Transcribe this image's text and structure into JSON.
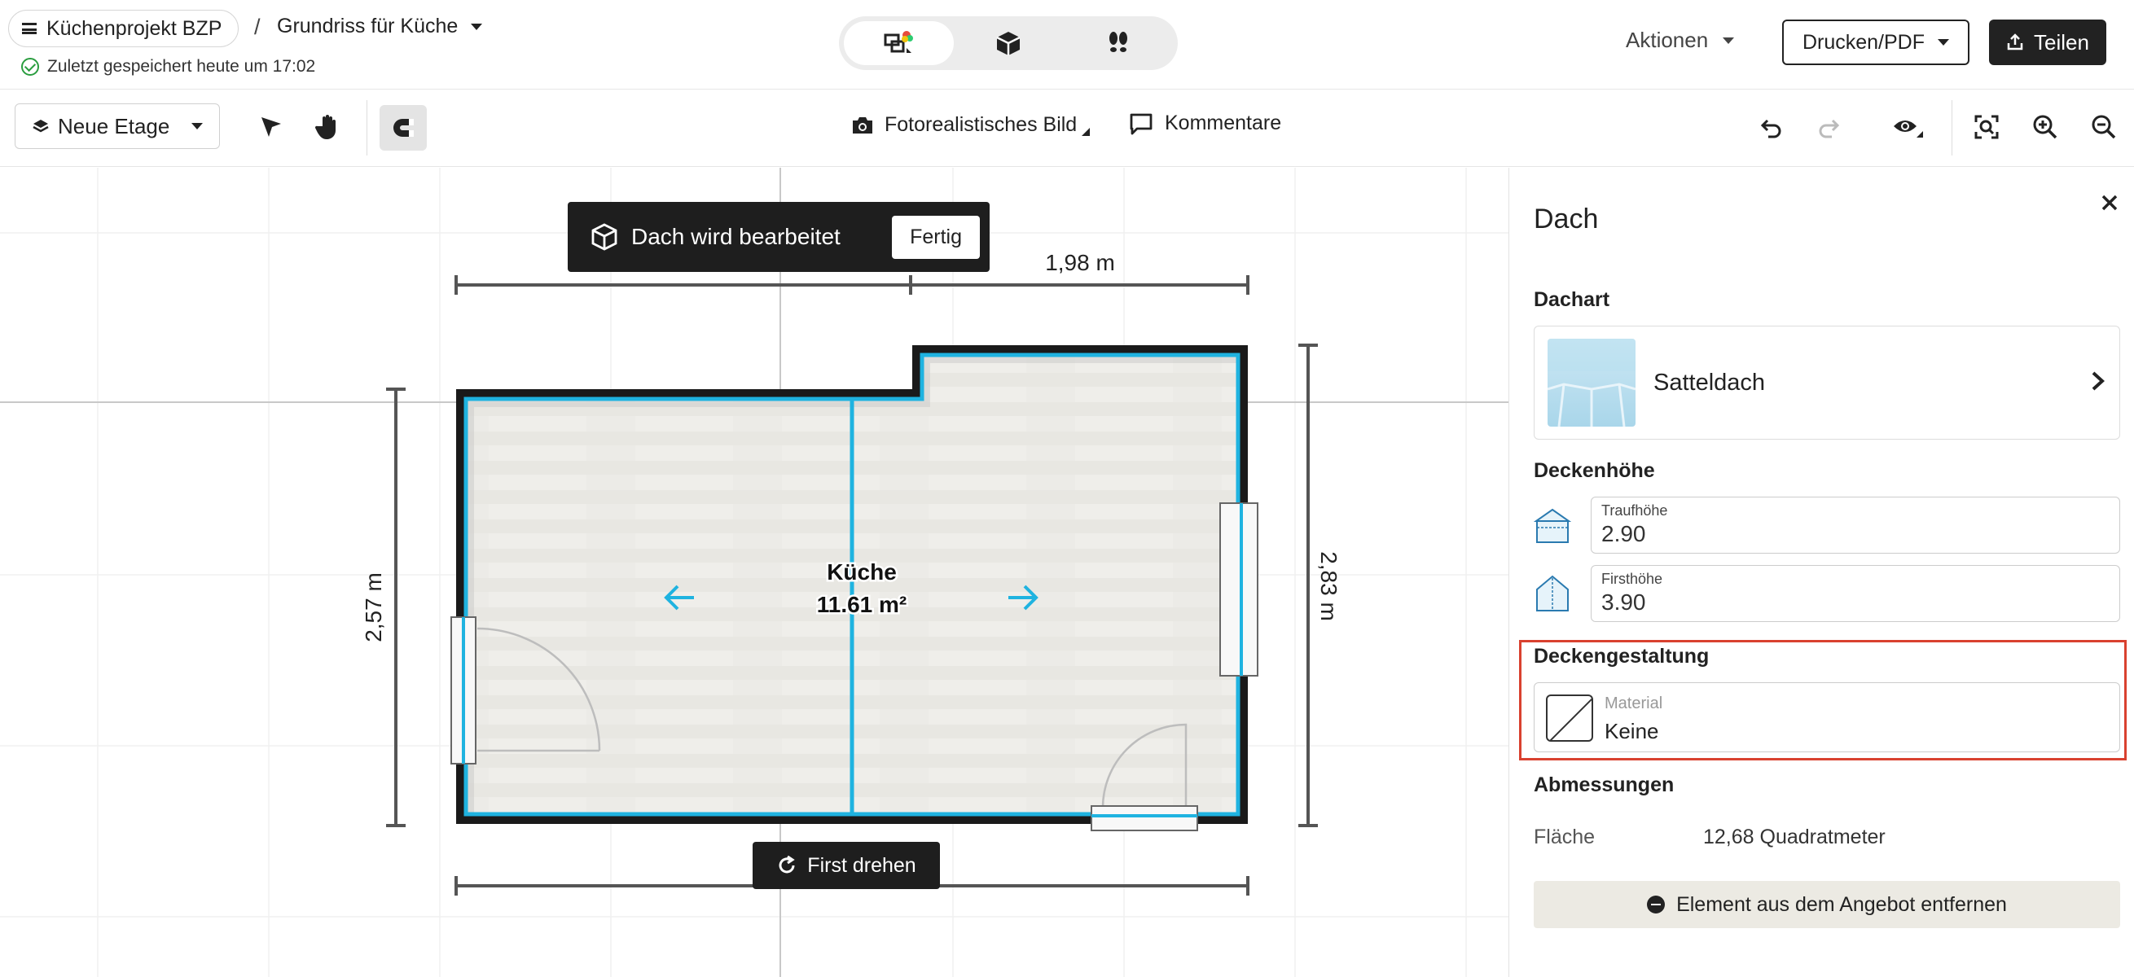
{
  "header": {
    "project_name": "Küchenprojekt BZP",
    "separator": "/",
    "plan_name": "Grundriss für Küche",
    "saved_status": "Zuletzt gespeichert heute um 17:02",
    "view_modes": [
      "2d-floorplan-icon",
      "3d-box-icon",
      "walkthrough-footprints-icon"
    ],
    "active_view": 0,
    "actions_label": "Aktionen",
    "print_label": "Drucken/PDF",
    "share_label": "Teilen"
  },
  "toolbar": {
    "floor_label": "Neue Etage",
    "photo_label": "Fotorealistisches Bild",
    "comments_label": "Kommentare"
  },
  "canvas": {
    "edit_banner_text": "Dach wird bearbeitet",
    "done_label": "Fertig",
    "rotate_label": "First drehen",
    "room_name": "Küche",
    "room_area": "11.61 m²",
    "dim_top": "1,98 m",
    "dim_left": "2,57 m",
    "dim_right": "2,83 m"
  },
  "panel": {
    "title": "Dach",
    "roof_type_label": "Dachart",
    "roof_type_value": "Satteldach",
    "ceiling_height_label": "Deckenhöhe",
    "eave_label": "Traufhöhe",
    "eave_value": "2.90",
    "ridge_label": "Firsthöhe",
    "ridge_value": "3.90",
    "ceiling_design_label": "Deckengestaltung",
    "material_label": "Material",
    "material_value": "Keine",
    "dimensions_label": "Abmessungen",
    "area_label": "Fläche",
    "area_value": "12,68 Quadratmeter",
    "remove_label": "Element aus dem Angebot entfernen"
  },
  "colors": {
    "accent_wall": "#1fb3e0",
    "highlight_box": "#d9412f",
    "dark": "#1e1e1e"
  }
}
